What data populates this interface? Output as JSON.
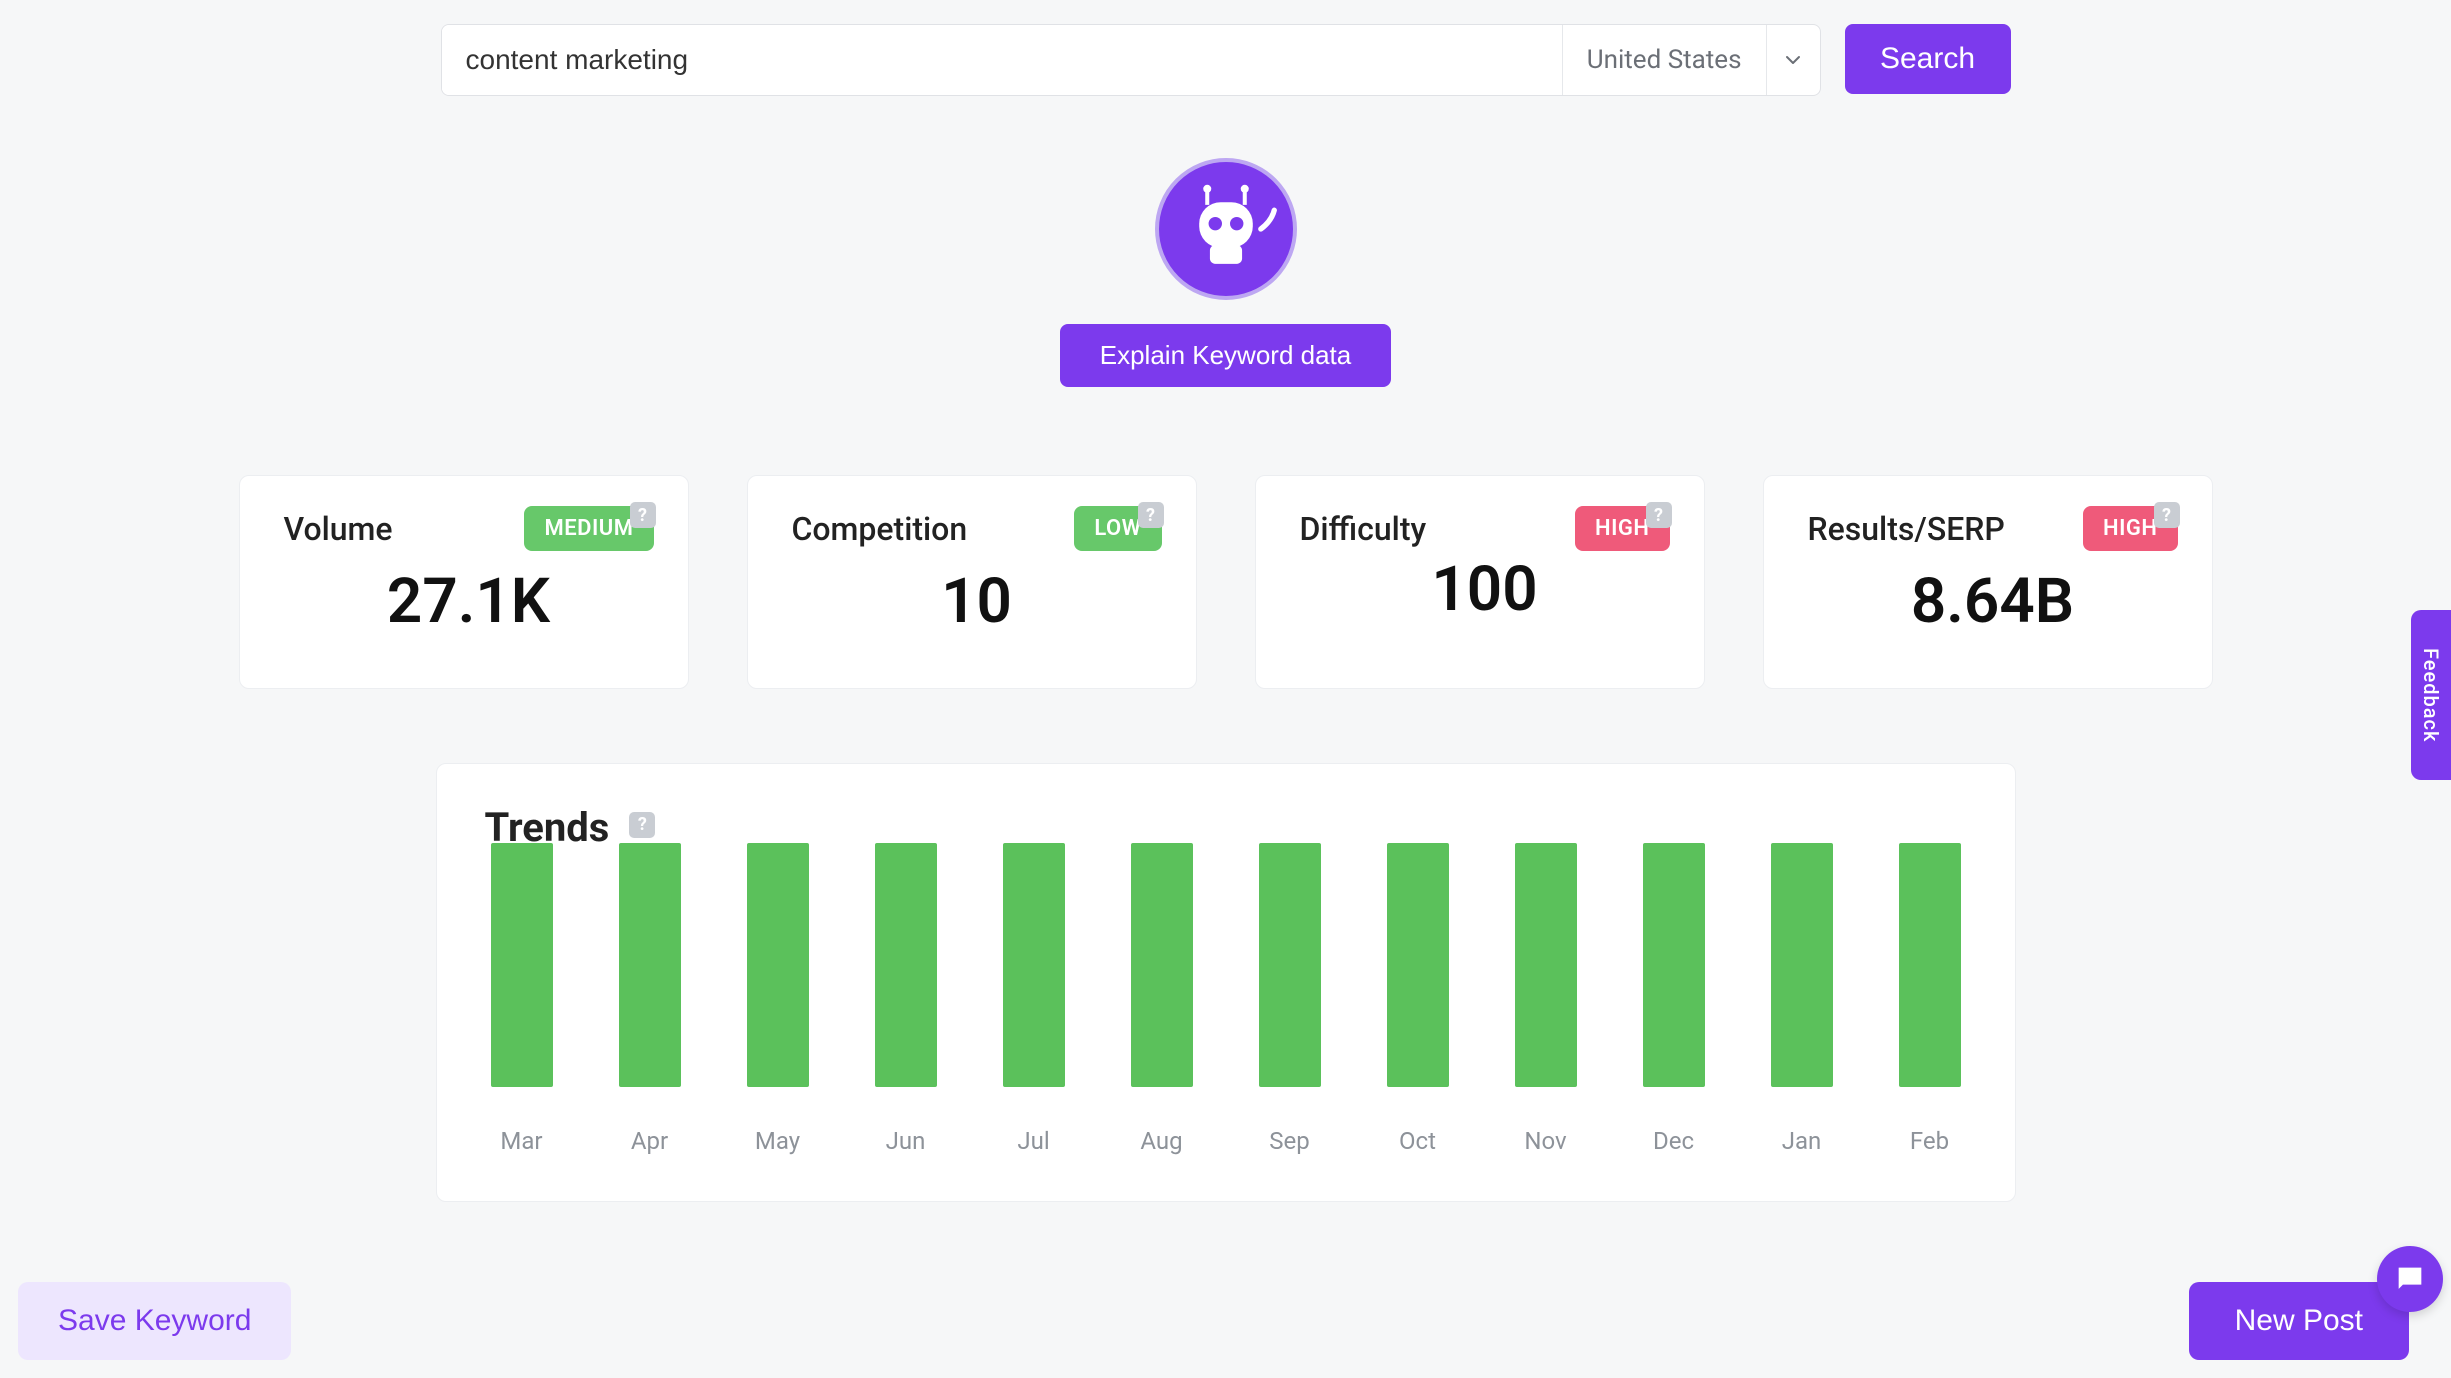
{
  "search": {
    "value": "content marketing",
    "country": "United States",
    "button": "Search"
  },
  "explain_button": "Explain Keyword data",
  "metrics": {
    "volume": {
      "title": "Volume",
      "badge": "MEDIUM",
      "badge_color": "green",
      "value": "27.1K"
    },
    "competition": {
      "title": "Competition",
      "badge": "LOW",
      "badge_color": "green",
      "value": "10"
    },
    "difficulty": {
      "title": "Difficulty",
      "badge": "HIGH",
      "badge_color": "pink",
      "value": "100"
    },
    "results": {
      "title": "Results/SERP",
      "badge": "HIGH",
      "badge_color": "pink",
      "value": "8.64B"
    }
  },
  "trends_title": "Trends",
  "chart_data": {
    "type": "bar",
    "title": "Trends",
    "categories": [
      "Mar",
      "Apr",
      "May",
      "Jun",
      "Jul",
      "Aug",
      "Sep",
      "Oct",
      "Nov",
      "Dec",
      "Jan",
      "Feb"
    ],
    "values": [
      100,
      100,
      100,
      100,
      100,
      100,
      100,
      100,
      100,
      100,
      100,
      100
    ],
    "ylim": [
      0,
      100
    ],
    "xlabel": "",
    "ylabel": ""
  },
  "footer": {
    "save": "Save Keyword",
    "new_post": "New Post"
  },
  "feedback": "Feedback",
  "help_glyph": "?"
}
